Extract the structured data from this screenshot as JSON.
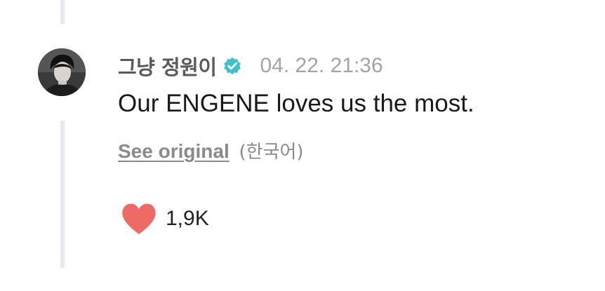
{
  "comment": {
    "author": "그냥 정원이",
    "verified_icon": "verified-badge-icon",
    "timestamp": "04. 22. 21:36",
    "text": "Our ENGENE loves us the most.",
    "translation": {
      "see_original_label": "See original",
      "source_language": "(한국어)"
    },
    "likes": {
      "icon": "heart-icon",
      "count": "1,9K"
    }
  },
  "colors": {
    "heart": "#ee6a64",
    "verified": "#3fc1c9",
    "thread_line": "#e8e8ee",
    "name": "#5a5a5a",
    "timestamp": "#a3a3a8",
    "body_text": "#1a1a1a"
  }
}
